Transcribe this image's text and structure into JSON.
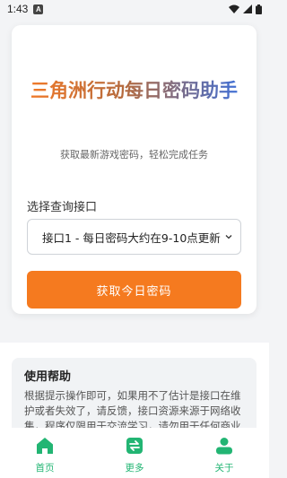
{
  "status_bar": {
    "time": "1:43",
    "notification_badge": "A"
  },
  "card": {
    "title": "三角洲行动每日密码助手",
    "subtitle": "获取最新游戏密码，轻松完成任务",
    "select_label": "选择查询接口",
    "select_value": "接口1 - 每日密码大约在9-10点更新",
    "submit_label": "获取今日密码"
  },
  "help": {
    "title": "使用帮助",
    "text": "根据提示操作即可，如果用不了估计是接口在维护或者失效了，请反馈，接口资源来源于网络收集，程序仅限用于交流学习，请勿用于任何商业用途"
  },
  "nav": {
    "items": [
      {
        "label": "首页",
        "icon": "home-icon"
      },
      {
        "label": "更多",
        "icon": "swap-icon"
      },
      {
        "label": "关于",
        "icon": "user-icon"
      }
    ]
  },
  "colors": {
    "accent": "#f57a1f",
    "nav_active": "#22b573",
    "title_gradient_start": "#f07a2a",
    "title_gradient_end": "#3f6fd6"
  }
}
